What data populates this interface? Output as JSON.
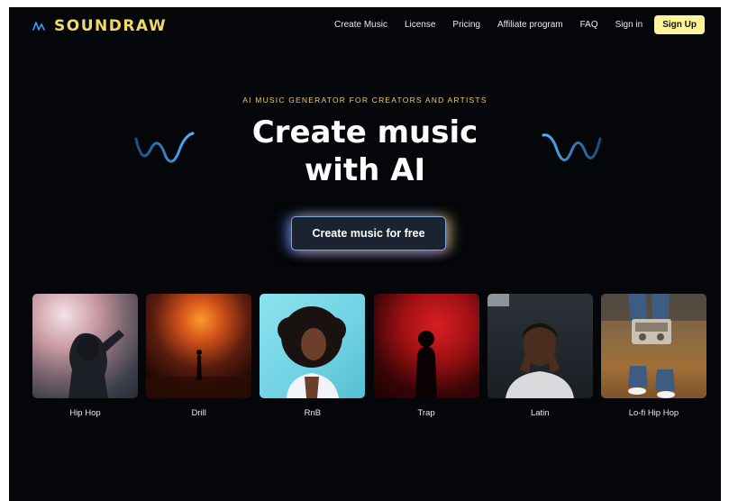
{
  "brand": {
    "name": "SOUNDRAW",
    "color": "#f3d86a"
  },
  "nav": {
    "links": [
      "Create Music",
      "License",
      "Pricing",
      "Affiliate program",
      "FAQ",
      "Sign in"
    ],
    "signup_label": "Sign Up",
    "signup_color": "#fff49a"
  },
  "hero": {
    "tagline": "AI MUSIC GENERATOR FOR CREATORS AND ARTISTS",
    "headline_line1": "Create music",
    "headline_line2": "with AI",
    "cta_label": "Create music for free",
    "wave_icon": "wave-squiggle-icon",
    "wave_color": "#3aa0f0"
  },
  "genres": [
    {
      "label": "Hip Hop",
      "image": "hooded-figure-in-smoke-photo"
    },
    {
      "label": "Drill",
      "image": "silhouette-in-orange-fog-photo"
    },
    {
      "label": "RnB",
      "image": "woman-with-curly-hair-photo"
    },
    {
      "label": "Trap",
      "image": "figure-in-red-smoke-photo"
    },
    {
      "label": "Latin",
      "image": "man-with-hands-to-face-photo"
    },
    {
      "label": "Lo-fi Hip Hop",
      "image": "person-holding-radio-photo"
    }
  ]
}
